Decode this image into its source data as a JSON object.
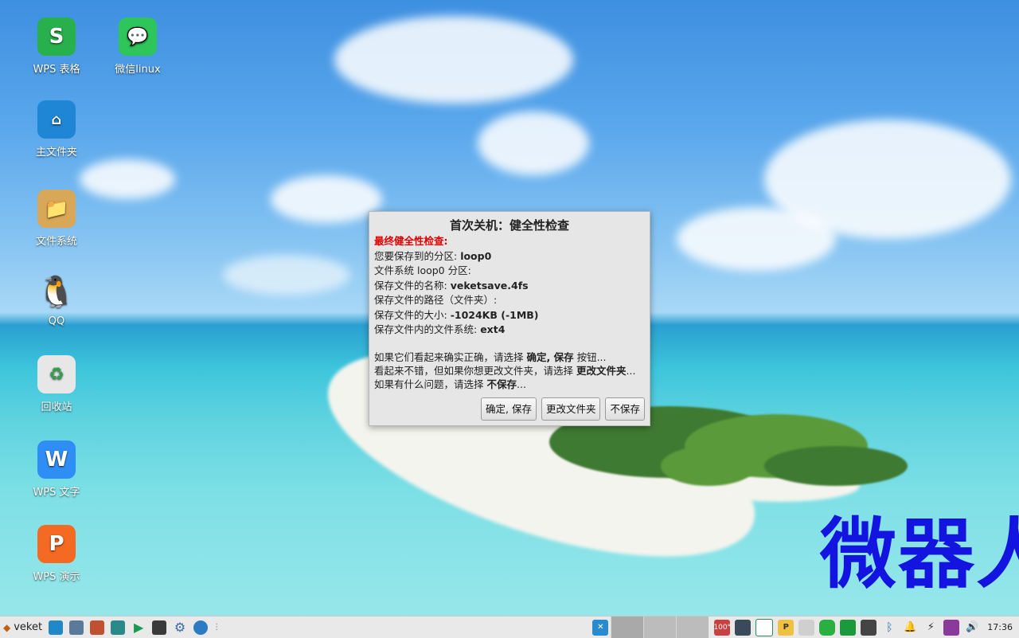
{
  "desktop": {
    "icons": [
      {
        "label": "WPS 表格",
        "glyph": "S"
      },
      {
        "label": "微信linux",
        "glyph": "💬"
      },
      {
        "label": "主文件夹",
        "glyph": "⌂"
      },
      {
        "label": "文件系统",
        "glyph": "📁"
      },
      {
        "label": "QQ",
        "glyph": "🐧"
      },
      {
        "label": "回收站",
        "glyph": "♻"
      },
      {
        "label": "WPS 文字",
        "glyph": "W"
      },
      {
        "label": "WPS 演示",
        "glyph": "P"
      }
    ],
    "watermark": "微器人"
  },
  "dialog": {
    "title": "首次关机：健全性检查",
    "warning": "最终健全性检查:",
    "lines": [
      {
        "label": "您要保存到的分区: ",
        "value": "loop0"
      },
      {
        "label": "文件系统 loop0 分区:",
        "value": ""
      },
      {
        "label": "保存文件的名称: ",
        "value": "veketsave.4fs"
      },
      {
        "label": "保存文件的路径（文件夹）:",
        "value": ""
      },
      {
        "label": "保存文件的大小: ",
        "value": "-1024KB (-1MB)"
      },
      {
        "label": "保存文件内的文件系统: ",
        "value": "ext4"
      }
    ],
    "messages": [
      {
        "pre": "如果它们看起来确实正确，请选择 ",
        "bold": "确定, 保存",
        "post": " 按钮..."
      },
      {
        "pre": "看起来不错，但如果你想更改文件夹，请选择 ",
        "bold": "更改文件夹",
        "post": "..."
      },
      {
        "pre": "如果有什么问题，请选择 ",
        "bold": "不保存",
        "post": "..."
      }
    ],
    "buttons": {
      "ok": "确定, 保存",
      "change": "更改文件夹",
      "nosave": "不保存"
    }
  },
  "taskbar": {
    "menu_label": "veket",
    "clock": "17:36",
    "battery_text": "100°",
    "colors": {
      "dialog_warning": "#e00000",
      "watermark": "#1414e0"
    }
  }
}
